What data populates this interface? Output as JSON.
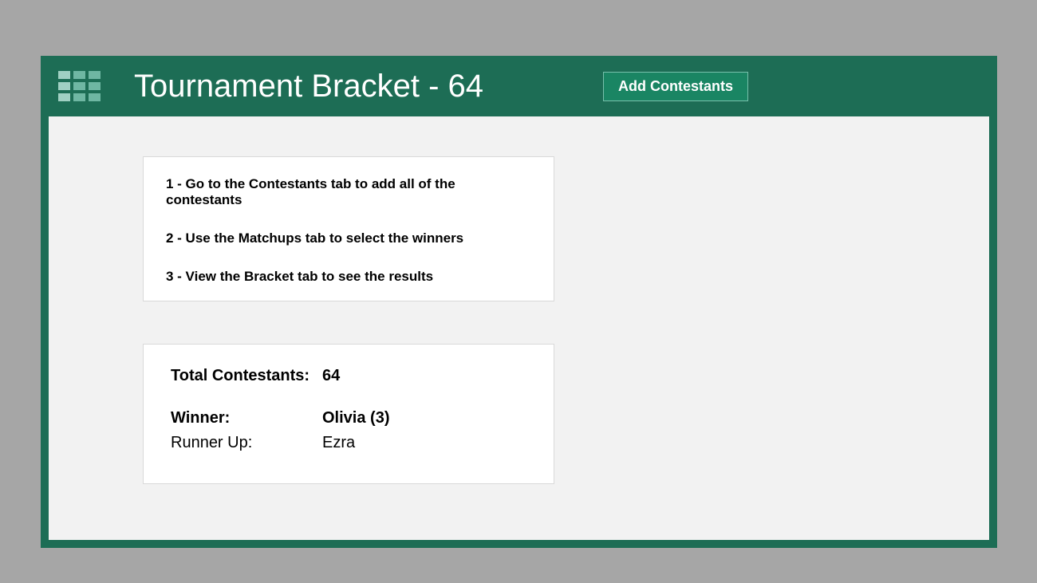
{
  "header": {
    "title": "Tournament Bracket - 64",
    "add_button": "Add Contestants"
  },
  "instructions": [
    "1 - Go to the Contestants tab to add all of the contestants",
    "2 - Use the Matchups tab to select the winners",
    "3 - View the Bracket tab to see the results"
  ],
  "summary": {
    "total_label": "Total Contestants:",
    "total_value": "64",
    "winner_label": "Winner:",
    "winner_value": "Olivia  (3)",
    "runnerup_label": "Runner Up:",
    "runnerup_value": "Ezra"
  }
}
